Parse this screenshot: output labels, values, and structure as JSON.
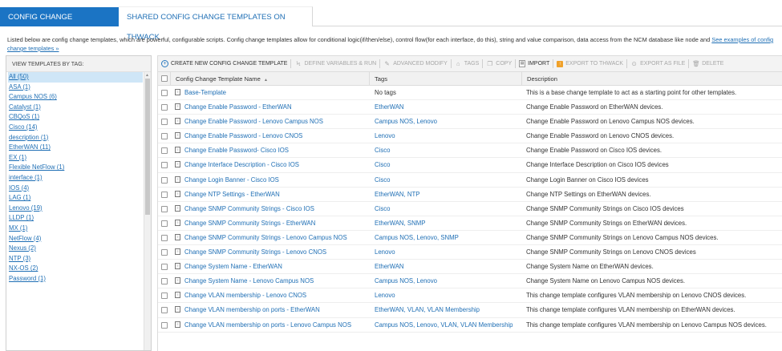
{
  "tabs": [
    {
      "label": "Config Change Templates",
      "active": true
    },
    {
      "label": "Shared Config Change Templates on THWACK",
      "active": false
    }
  ],
  "intro": {
    "text": "Listed below are config change templates, which are powerful, configurable scripts. Config change templates allow for conditional logic(if/then/else), control flow(for each interface, do this), string and value comparison, data access from the NCM database like node and ",
    "link": "See examples of config change templates »"
  },
  "sidebar": {
    "heading": "View templates by tag:",
    "tags": [
      {
        "label": "All (50)",
        "selected": true
      },
      {
        "label": "ASA (1)"
      },
      {
        "label": "Campus NOS (6)"
      },
      {
        "label": "Catalyst (1)"
      },
      {
        "label": "CBQoS (1)"
      },
      {
        "label": "Cisco (14)"
      },
      {
        "label": "description (1)"
      },
      {
        "label": "EtherWAN (11)"
      },
      {
        "label": "EX (1)"
      },
      {
        "label": "Flexible NetFlow (1)"
      },
      {
        "label": "interface (1)"
      },
      {
        "label": "IOS (4)"
      },
      {
        "label": "LAG (1)"
      },
      {
        "label": "Lenovo (19)"
      },
      {
        "label": "LLDP (1)"
      },
      {
        "label": "MX (1)"
      },
      {
        "label": "NetFlow (4)"
      },
      {
        "label": "Nexus (2)"
      },
      {
        "label": "NTP (3)"
      },
      {
        "label": "NX-OS (2)"
      },
      {
        "label": "Password (1)"
      }
    ]
  },
  "toolbar": {
    "items": [
      {
        "label": "Create New Config Change Template",
        "icon": "plus-circle-icon",
        "enabled": true
      },
      {
        "label": "Define Variables & Run",
        "icon": "lightning-icon",
        "enabled": false
      },
      {
        "label": "Advanced Modify",
        "icon": "pencil-icon",
        "enabled": false
      },
      {
        "label": "Tags",
        "icon": "tag-icon",
        "enabled": false
      },
      {
        "label": "Copy",
        "icon": "copy-icon",
        "enabled": false
      },
      {
        "label": "Import",
        "icon": "import-icon",
        "enabled": true
      },
      {
        "label": "Export to THWACK",
        "icon": "export-thwack-icon",
        "enabled": false
      },
      {
        "label": "Export as File",
        "icon": "export-file-icon",
        "enabled": false
      },
      {
        "label": "Delete",
        "icon": "trash-icon",
        "enabled": false
      }
    ]
  },
  "grid": {
    "columns": {
      "name": "Config Change Template Name",
      "name_sort": "▲",
      "tags": "Tags",
      "description": "Description"
    },
    "rows": [
      {
        "name": "Base-Template",
        "tags": "No tags",
        "plain": true,
        "description": "This is a base change template to act as a starting point for other templates."
      },
      {
        "name": "Change Enable Password - EtherWAN",
        "tags": "EtherWAN",
        "description": "Change Enable Password on EtherWAN devices."
      },
      {
        "name": "Change Enable Password - Lenovo Campus NOS",
        "tags": "Campus NOS, Lenovo",
        "description": "Change Enable Password on Lenovo Campus NOS devices."
      },
      {
        "name": "Change Enable Password - Lenovo CNOS",
        "tags": "Lenovo",
        "description": "Change Enable Password on Lenovo CNOS devices."
      },
      {
        "name": "Change Enable Password- Cisco IOS",
        "tags": "Cisco",
        "description": "Change Enable Password on Cisco IOS devices."
      },
      {
        "name": "Change Interface Description - Cisco IOS",
        "tags": "Cisco",
        "description": "Change Interface Description on Cisco IOS devices"
      },
      {
        "name": "Change Login Banner - Cisco IOS",
        "tags": "Cisco",
        "description": "Change Login Banner on Cisco IOS devices"
      },
      {
        "name": "Change NTP Settings - EtherWAN",
        "tags": "EtherWAN, NTP",
        "description": "Change NTP Settings on EtherWAN devices."
      },
      {
        "name": "Change SNMP Community Strings - Cisco IOS",
        "tags": "Cisco",
        "description": "Change SNMP Community Strings on Cisco IOS devices"
      },
      {
        "name": "Change SNMP Community Strings - EtherWAN",
        "tags": "EtherWAN, SNMP",
        "description": "Change SNMP Community Strings on EtherWAN devices."
      },
      {
        "name": "Change SNMP Community Strings - Lenovo Campus NOS",
        "tags": "Campus NOS, Lenovo, SNMP",
        "description": "Change SNMP Community Strings on Lenovo Campus NOS devices."
      },
      {
        "name": "Change SNMP Community Strings - Lenovo CNOS",
        "tags": "Lenovo",
        "description": "Change SNMP Community Strings on Lenovo CNOS devices"
      },
      {
        "name": "Change System Name - EtherWAN",
        "tags": "EtherWAN",
        "description": "Change System Name on EtherWAN devices."
      },
      {
        "name": "Change System Name - Lenovo Campus NOS",
        "tags": "Campus NOS, Lenovo",
        "description": "Change System Name on Lenovo Campus NOS devices."
      },
      {
        "name": "Change VLAN membership - Lenovo CNOS",
        "tags": "Lenovo",
        "description": "This change template configures VLAN membership on Lenovo CNOS devices."
      },
      {
        "name": "Change VLAN membership on ports - EtherWAN",
        "tags": "EtherWAN, VLAN, VLAN Membership",
        "description": "This change template configures VLAN membership on EtherWAN devices."
      },
      {
        "name": "Change VLAN membership on ports - Lenovo Campus NOS",
        "tags": "Campus NOS, Lenovo, VLAN, VLAN Membership",
        "description": "This change template configures VLAN membership on Lenovo Campus NOS devices."
      }
    ]
  }
}
